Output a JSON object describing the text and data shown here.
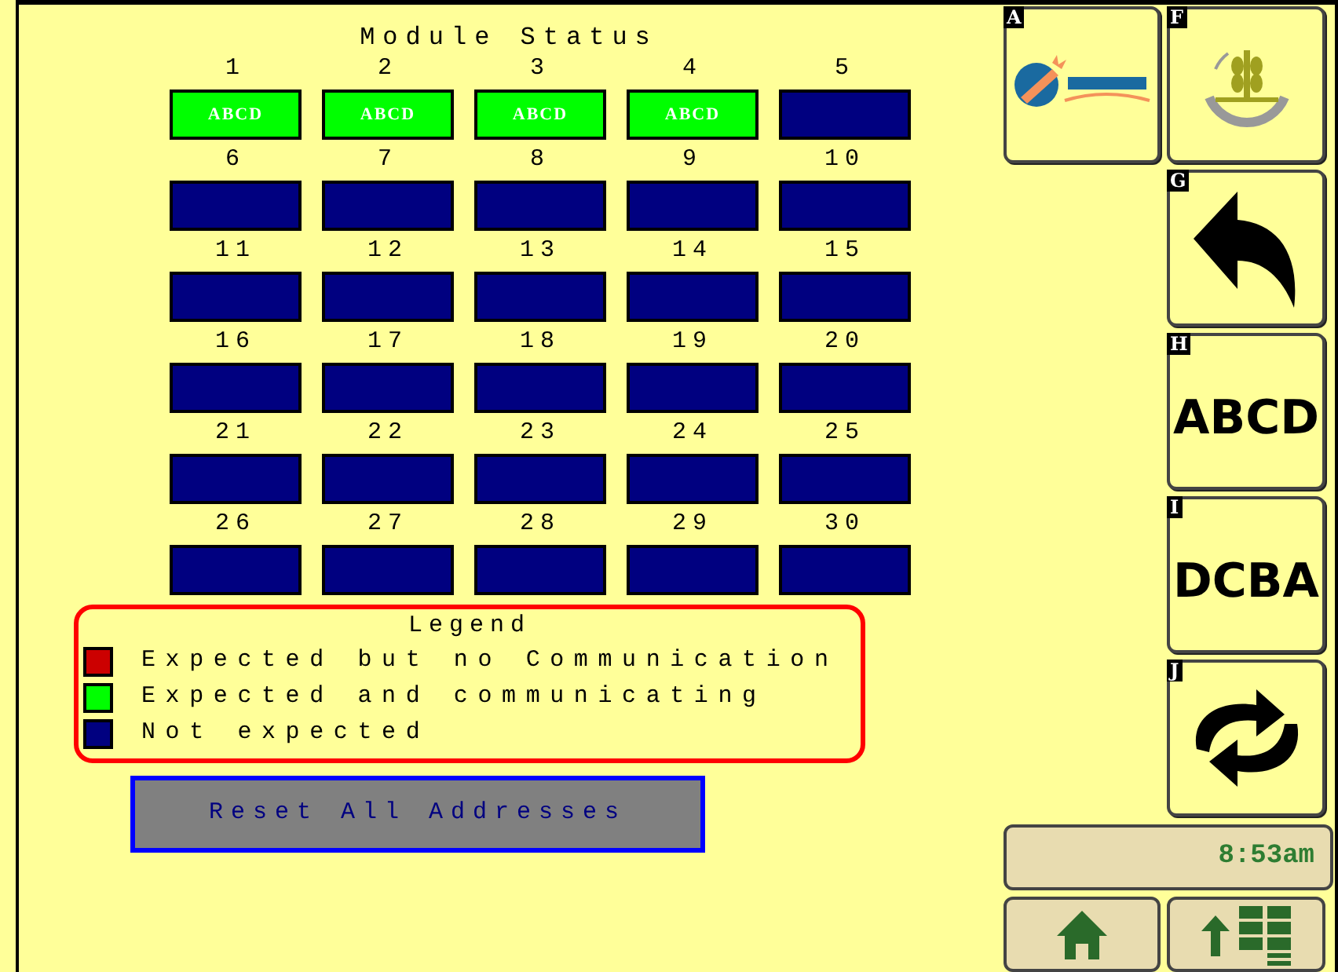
{
  "title": "Module Status",
  "modules": [
    {
      "number": "1",
      "label": "ABCD",
      "color": "#00ff00"
    },
    {
      "number": "2",
      "label": "ABCD",
      "color": "#00ff00"
    },
    {
      "number": "3",
      "label": "ABCD",
      "color": "#00ff00"
    },
    {
      "number": "4",
      "label": "ABCD",
      "color": "#00ff00"
    },
    {
      "number": "5",
      "color": "#000080"
    },
    {
      "number": "6",
      "color": "#000080"
    },
    {
      "number": "7",
      "color": "#000080"
    },
    {
      "number": "8",
      "color": "#000080"
    },
    {
      "number": "9",
      "color": "#000080"
    },
    {
      "number": "10",
      "color": "#000080"
    },
    {
      "number": "11",
      "color": "#000080"
    },
    {
      "number": "12",
      "color": "#000080"
    },
    {
      "number": "13",
      "color": "#000080"
    },
    {
      "number": "14",
      "color": "#000080"
    },
    {
      "number": "15",
      "color": "#000080"
    },
    {
      "number": "16",
      "color": "#000080"
    },
    {
      "number": "17",
      "color": "#000080"
    },
    {
      "number": "18",
      "color": "#000080"
    },
    {
      "number": "19",
      "color": "#000080"
    },
    {
      "number": "20",
      "color": "#000080"
    },
    {
      "number": "21",
      "color": "#000080"
    },
    {
      "number": "22",
      "color": "#000080"
    },
    {
      "number": "23",
      "color": "#000080"
    },
    {
      "number": "24",
      "color": "#000080"
    },
    {
      "number": "25",
      "color": "#000080"
    },
    {
      "number": "26",
      "color": "#000080"
    },
    {
      "number": "27",
      "color": "#000080"
    },
    {
      "number": "28",
      "color": "#000080"
    },
    {
      "number": "29",
      "color": "#000080"
    },
    {
      "number": "30",
      "color": "#000080"
    }
  ],
  "legend": {
    "title": "Legend",
    "items": [
      {
        "label": "Expected but no Communication",
        "color": "#cc0000"
      },
      {
        "label": "Expected and communicating",
        "color": "#00ff00"
      },
      {
        "label": "Not expected",
        "color": "#000080"
      }
    ]
  },
  "reset_button": "Reset All Addresses",
  "softkeys": [
    {
      "key": "A",
      "kind": "logo-sun"
    },
    {
      "key": "F",
      "kind": "logo-wheat"
    },
    {
      "key": "G",
      "kind": "back"
    },
    {
      "key": "H",
      "kind": "text",
      "label": "ABCD"
    },
    {
      "key": "I",
      "kind": "text",
      "label": "DCBA"
    },
    {
      "key": "J",
      "kind": "cycle"
    }
  ],
  "clock": "8:53am"
}
